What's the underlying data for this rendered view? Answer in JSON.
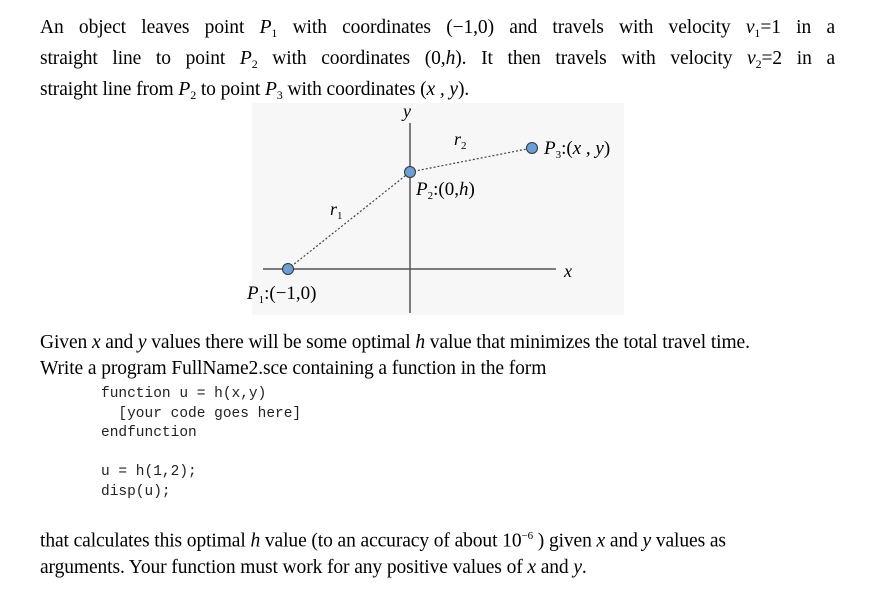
{
  "intro": {
    "lines": [
      [
        "An object leaves point ",
        {
          "m": "P",
          "s": "1"
        },
        " with coordinates ",
        {
          "t": "(−1,0)"
        },
        " and travels with velocity ",
        {
          "m": "v",
          "s": "1"
        },
        {
          "t": "=1"
        },
        " in a"
      ],
      [
        "straight line to point ",
        {
          "m": "P",
          "s": "2"
        },
        " with coordinates ",
        {
          "t": "(0,"
        },
        {
          "m": "h"
        },
        {
          "t": ")"
        },
        ". It then travels with velocity ",
        {
          "m": "v",
          "s": "2"
        },
        {
          "t": "=2"
        },
        " in a"
      ],
      [
        "straight line from ",
        {
          "m": "P",
          "s": "2"
        },
        " to point ",
        {
          "m": "P",
          "s": "3"
        },
        " with coordinates ",
        {
          "t": "("
        },
        {
          "m": "x , y"
        },
        {
          "t": ")"
        },
        "."
      ]
    ]
  },
  "diagram": {
    "axis_x_label": "x",
    "axis_y_label": "y",
    "r1_label": "r",
    "r1_sub": "1",
    "r2_label": "r",
    "r2_sub": "2",
    "p1_label": "P",
    "p1_sub": "1",
    "p1_coords": ":(−1,0)",
    "p2_label": "P",
    "p2_sub": "2",
    "p2_coords_pre": ":(0,",
    "p2_coords_h": "h",
    "p2_coords_post": ")",
    "p3_label": "P",
    "p3_sub": "3",
    "p3_coords_pre": ":(",
    "p3_coords_xy": "x , y",
    "p3_coords_post": ")",
    "point_color": "#6a9fd8",
    "axis_color": "#555555",
    "background": "#f7f7f7"
  },
  "given": {
    "line1_a": "Given ",
    "line1_x": "x",
    "line1_b": " and ",
    "line1_y": "y",
    "line1_c": " values there will be some optimal ",
    "line1_h": "h",
    "line1_d": " value that minimizes the total travel time.",
    "line2": "Write a program FullName2.sce containing a function in the form"
  },
  "code": {
    "lines": [
      "function u = h(x,y)",
      "  [your code goes here]",
      "endfunction",
      "",
      "u = h(1,2);",
      "disp(u);"
    ]
  },
  "closing": {
    "line1_a": "that calculates this optimal ",
    "line1_h": "h",
    "line1_b": " value (to an accuracy of about  10",
    "line1_exp": "−6",
    "line1_c": " ) given ",
    "line1_x": "x",
    "line1_d": " and ",
    "line1_y": "y",
    "line1_e": " values as",
    "line2_a": "arguments. Your function must work for any positive values of ",
    "line2_x": "x",
    "line2_b": " and ",
    "line2_y": "y",
    "line2_c": "."
  }
}
